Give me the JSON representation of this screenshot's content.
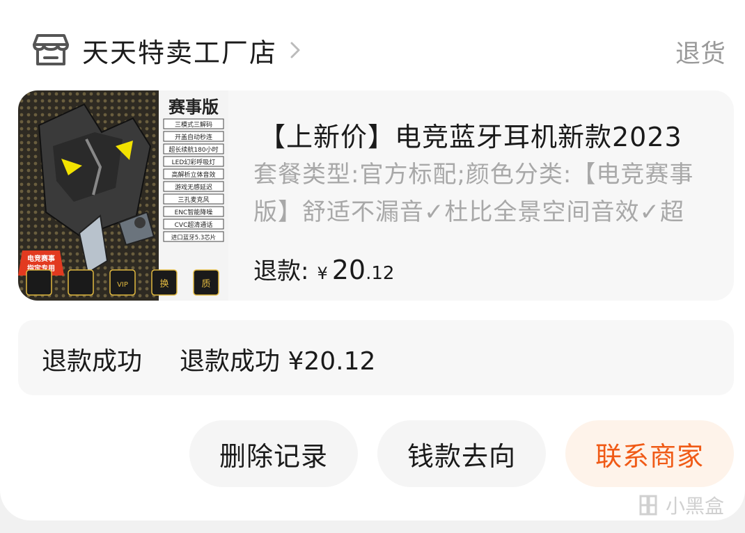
{
  "store": {
    "name": "天天特卖工厂店",
    "status": "退货"
  },
  "product": {
    "title": "【上新价】电竞蓝牙耳机新款2023",
    "desc": "套餐类型:官方标配;颜色分类:【电竞赛事版】舒适不漏音✓杜比全景空间音效✓超",
    "refund_label": "退款:",
    "currency": "¥",
    "amount_int": "20",
    "amount_dec": ".12",
    "thumb": {
      "badge": "赛事版",
      "features": [
        "三模式三解码",
        "开盖自动秒连",
        "超长续航180小时",
        "LED幻彩呼吸灯",
        "高解析立体音效",
        "游戏无感延迟",
        "三孔麦克风",
        "ENC智能降噪",
        "CVC超清通话",
        "进口蓝牙5.3芯片"
      ],
      "tag_line1": "电竞赛事",
      "tag_line2": "指定专用",
      "bottom_icons": [
        "",
        "",
        "VIP",
        "换",
        "质"
      ]
    }
  },
  "refund": {
    "label": "退款成功",
    "value": "退款成功 ¥20.12"
  },
  "buttons": {
    "delete": "删除记录",
    "money_flow": "钱款去向",
    "contact": "联系商家"
  },
  "watermark": "小黑盒",
  "colors": {
    "accent": "#f05a16",
    "accent_bg": "#fef3ea"
  }
}
